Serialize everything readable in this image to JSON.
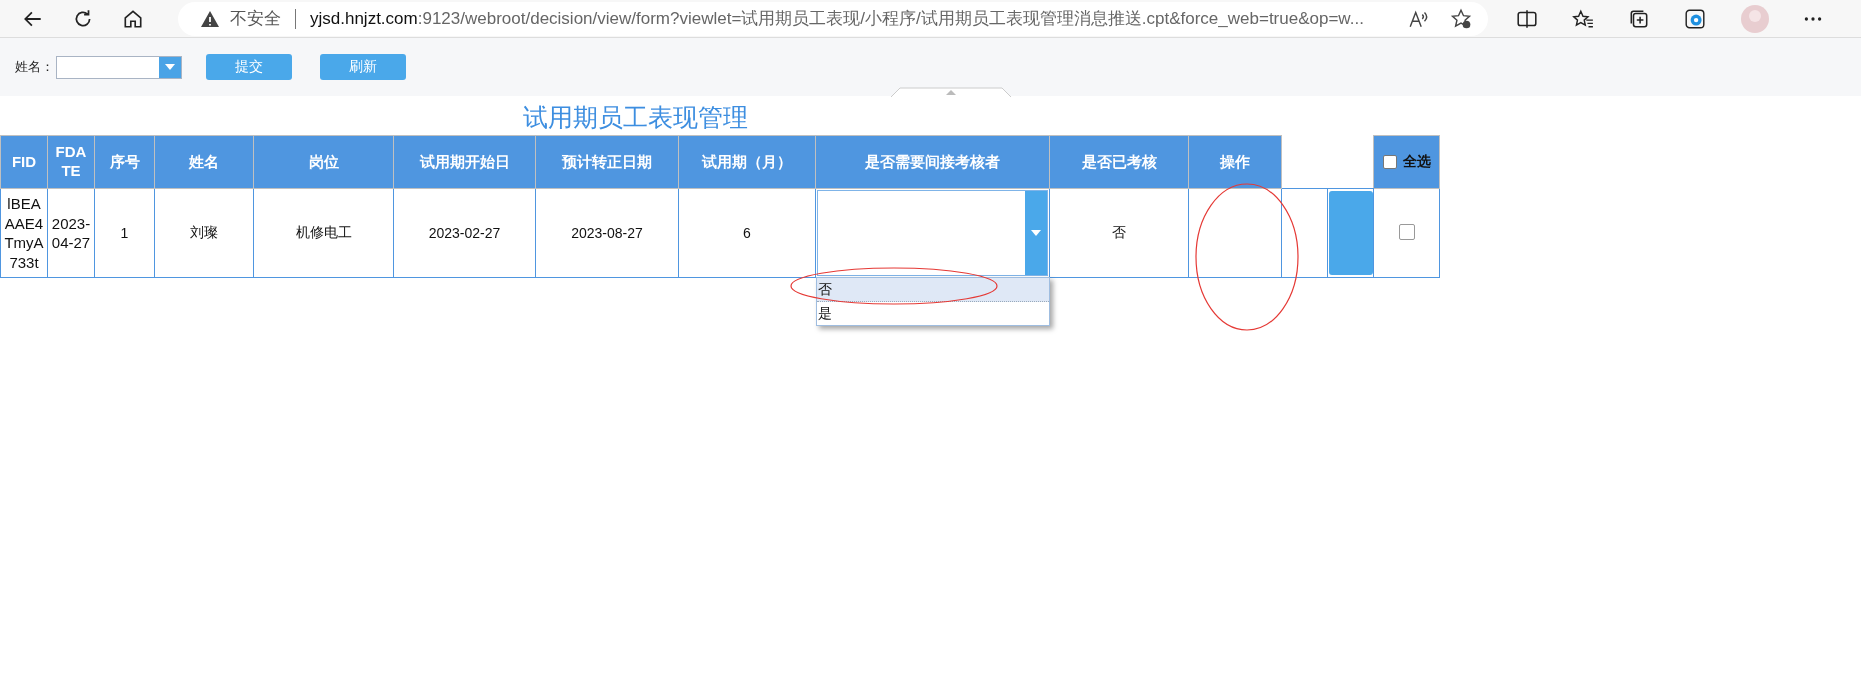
{
  "browser": {
    "security": "不安全",
    "url_host": "yjsd.hnjzt.com",
    "url_rest": ":9123/webroot/decision/view/form?viewlet=试用期员工表现/小程序/试用期员工表现管理消息推送.cpt&force_web=true&op=w..."
  },
  "toolbar": {
    "name_label": "姓名：",
    "buttons": [
      "提交",
      "刷新"
    ]
  },
  "title": "试用期员工表现管理",
  "table": {
    "columns": [
      "FID",
      "FDATE",
      "序号",
      "姓名",
      "岗位",
      "试用期开始日",
      "预计转正日期",
      "试用期（月）",
      "是否需要间接考核者",
      "是否已考核",
      "操作"
    ],
    "select_all": {
      "label": "全选",
      "checked": false
    },
    "rows": [
      {
        "cells": [
          "lBEAAAE4TmyA733t",
          "2023-04-27",
          "1",
          "刘璨",
          "机修电工",
          "2023-02-27",
          "2023-08-27",
          "6"
        ],
        "reviewed": "否",
        "checked": false
      }
    ]
  },
  "dropdown": {
    "options": [
      {
        "label": "否",
        "selected": true
      },
      {
        "label": "是",
        "selected": false
      }
    ]
  }
}
